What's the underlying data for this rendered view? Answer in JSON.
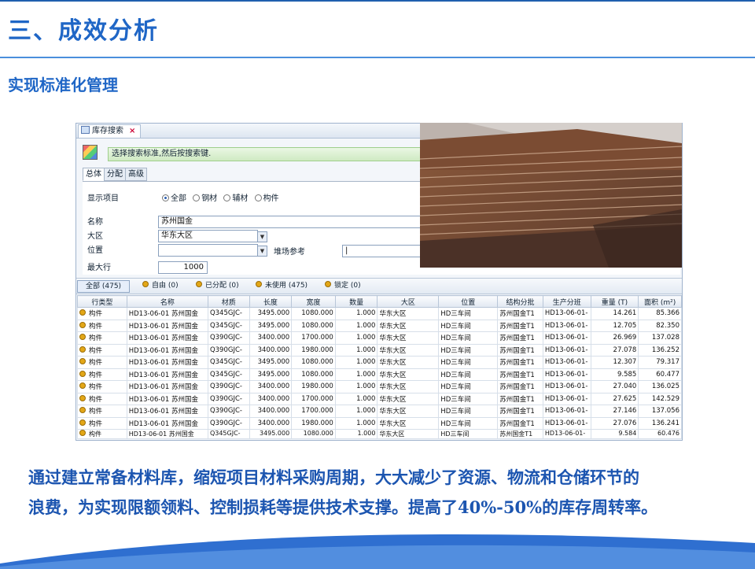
{
  "slide": {
    "title": "三、成效分析",
    "subtitle": "实现标准化管理",
    "summary_line1": "通过建立常备材料库，缩短项目材料采购周期，大大减少了资源、物流和仓储环节的",
    "summary_line2": "浪费，为实现限额领料、控制损耗等提供技术支撑。提高了40%-50%的库存周转率。"
  },
  "app": {
    "doc_tab": "库存搜索",
    "close_glyph": "×",
    "hint": "选择搜索标准,然后按搜索键.",
    "sub_tabs": [
      "总体",
      "分配",
      "高级"
    ],
    "form": {
      "display_label": "显示项目",
      "radio_options": [
        "全部",
        "钢材",
        "辅材",
        "构件"
      ],
      "selected_radio": "全部",
      "name_label": "名称",
      "name_value": "苏州国金",
      "region_label": "大区",
      "region_value": "华东大区",
      "position_label": "位置",
      "position_value": "",
      "yard_label": "堆场参考",
      "yard_value": "|",
      "maxrows_label": "最大行",
      "maxrows_value": "1000"
    },
    "filters": [
      "全部 (475)",
      "自由 (0)",
      "已分配 (0)",
      "未使用 (475)",
      "锁定 (0)"
    ],
    "columns": [
      "行类型",
      "名称",
      "材质",
      "长度",
      "宽度",
      "数量",
      "大区",
      "位置",
      "结构分批",
      "生产分班",
      "重量 (T)",
      "面积 (m²)"
    ],
    "rows": [
      [
        "构件",
        "HD13-06-01 苏州国金",
        "Q345GJC-",
        "3495.000",
        "1080.000",
        "1.000",
        "华东大区",
        "HD三车间",
        "苏州国金T1",
        "HD13-06-01-",
        "14.261",
        "85.366"
      ],
      [
        "构件",
        "HD13-06-01 苏州国金",
        "Q345GJC-",
        "3495.000",
        "1080.000",
        "1.000",
        "华东大区",
        "HD三车间",
        "苏州国金T1",
        "HD13-06-01-",
        "12.705",
        "82.350"
      ],
      [
        "构件",
        "HD13-06-01 苏州国金",
        "Q390GJC-",
        "3400.000",
        "1700.000",
        "1.000",
        "华东大区",
        "HD三车间",
        "苏州国金T1",
        "HD13-06-01-",
        "26.969",
        "137.028"
      ],
      [
        "构件",
        "HD13-06-01 苏州国金",
        "Q390GJC-",
        "3400.000",
        "1980.000",
        "1.000",
        "华东大区",
        "HD三车间",
        "苏州国金T1",
        "HD13-06-01-",
        "27.078",
        "136.252"
      ],
      [
        "构件",
        "HD13-06-01 苏州国金",
        "Q345GJC-",
        "3495.000",
        "1080.000",
        "1.000",
        "华东大区",
        "HD三车间",
        "苏州国金T1",
        "HD13-06-01-",
        "12.307",
        "79.317"
      ],
      [
        "构件",
        "HD13-06-01 苏州国金",
        "Q345GJC-",
        "3495.000",
        "1080.000",
        "1.000",
        "华东大区",
        "HD三车间",
        "苏州国金T1",
        "HD13-06-01-",
        "9.585",
        "60.477"
      ],
      [
        "构件",
        "HD13-06-01 苏州国金",
        "Q390GJC-",
        "3400.000",
        "1980.000",
        "1.000",
        "华东大区",
        "HD三车间",
        "苏州国金T1",
        "HD13-06-01-",
        "27.040",
        "136.025"
      ],
      [
        "构件",
        "HD13-06-01 苏州国金",
        "Q390GJC-",
        "3400.000",
        "1700.000",
        "1.000",
        "华东大区",
        "HD三车间",
        "苏州国金T1",
        "HD13-06-01-",
        "27.625",
        "142.529"
      ],
      [
        "构件",
        "HD13-06-01 苏州国金",
        "Q390GJC-",
        "3400.000",
        "1700.000",
        "1.000",
        "华东大区",
        "HD三车间",
        "苏州国金T1",
        "HD13-06-01-",
        "27.146",
        "137.056"
      ],
      [
        "构件",
        "HD13-06-01 苏州国金",
        "Q390GJC-",
        "3400.000",
        "1980.000",
        "1.000",
        "华东大区",
        "HD三车间",
        "苏州国金T1",
        "HD13-06-01-",
        "27.076",
        "136.241"
      ],
      [
        "构件",
        "HD13-06-01 苏州国金",
        "Q345GJC-",
        "3495.000",
        "1080.000",
        "1.000",
        "华东大区",
        "HD三车间",
        "苏州国金T1",
        "HD13-06-01-",
        "9.584",
        "60.476"
      ]
    ]
  },
  "colors": {
    "title_blue": "#1f66c6",
    "summary_blue": "#1c55b0",
    "hint_green": "#cfeac2",
    "wave_blue": "#2f6fd0"
  }
}
